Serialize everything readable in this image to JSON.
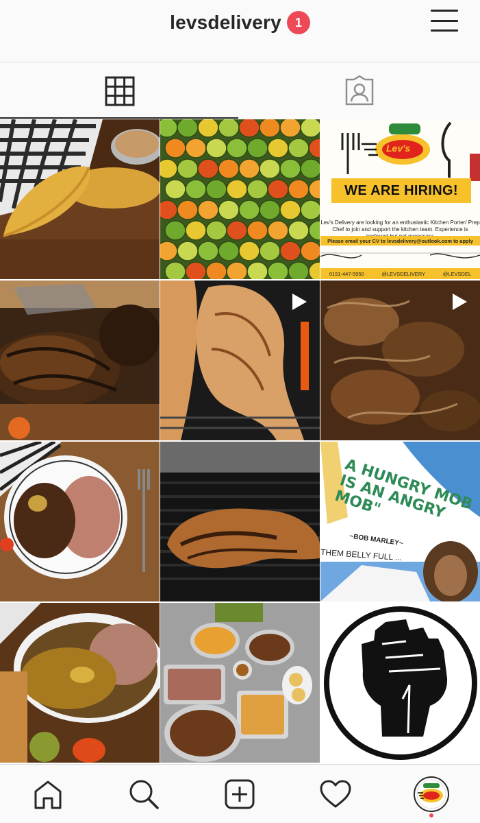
{
  "header": {
    "username": "levsdelivery",
    "notification_count": "1"
  },
  "tabs": [
    {
      "name": "grid-icon"
    },
    {
      "name": "tagged-icon"
    }
  ],
  "posts": [
    {
      "id": 1,
      "kind": "photo",
      "subject": "patties"
    },
    {
      "id": 2,
      "kind": "photo",
      "subject": "scotch-bonnet-peppers"
    },
    {
      "id": 3,
      "kind": "graphic",
      "subject": "we-are-hiring"
    },
    {
      "id": 4,
      "kind": "photo",
      "subject": "jerk-chicken"
    },
    {
      "id": 5,
      "kind": "video",
      "subject": "grilled-chicken-leg"
    },
    {
      "id": 6,
      "kind": "video",
      "subject": "brown-stew"
    },
    {
      "id": 7,
      "kind": "photo",
      "subject": "curry-goat-rice"
    },
    {
      "id": 8,
      "kind": "photo",
      "subject": "grilled-chicken"
    },
    {
      "id": 9,
      "kind": "graphic",
      "subject": "hungry-mob-quote"
    },
    {
      "id": 10,
      "kind": "photo",
      "subject": "curry-chicken-rice"
    },
    {
      "id": 11,
      "kind": "photo",
      "subject": "food-spread"
    },
    {
      "id": 12,
      "kind": "graphic",
      "subject": "raised-fist"
    }
  ],
  "hiring_post": {
    "title": "WE ARE HIRING!",
    "logo_text": "Lev's",
    "body": "Lev's Delivery are looking for an enthusiastic Kitchen Porter/ Prep Chef to join and support the kitchen team. Experience is preferred but not necessary.",
    "email_line": "Please email your CV to levsdelivery@outlook.com to apply",
    "phone": "0191-447-5950",
    "instagram": "@LEVSDELIVERY",
    "facebook": "@LEVSDEL"
  },
  "quote_post": {
    "quote": "A HUNGRY MOB\nIS AN ANGRY\nMOB\"",
    "author": "~BOB MARLEY~",
    "sub": "THEM BELLY FULL ..."
  },
  "colors": {
    "accent_red": "#ed4956",
    "text_dark": "#262626",
    "divider": "#dbdbdb",
    "hiring_yellow": "#f6c12a",
    "quote_green": "#2e8b57"
  },
  "bottom_nav": [
    {
      "name": "home-icon"
    },
    {
      "name": "search-icon"
    },
    {
      "name": "add-post-icon"
    },
    {
      "name": "heart-icon"
    },
    {
      "name": "profile-avatar"
    }
  ]
}
